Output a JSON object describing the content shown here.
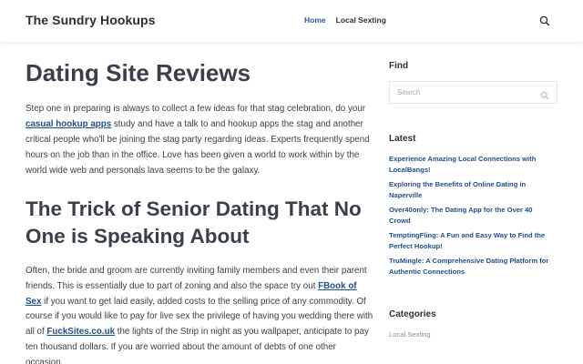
{
  "header": {
    "site_title": "The Sundry Hookups",
    "nav": [
      {
        "label": "Home",
        "active": true
      },
      {
        "label": "Local Sexting",
        "active": false
      }
    ],
    "search_icon": "search-icon"
  },
  "main": {
    "heading": "Dating Site Reviews",
    "para1": {
      "before_link": "Step one in preparing is always to collect a few ideas for that stag celebration, do your ",
      "link": "casual hookup apps",
      "after_link": " study and have a talk to and hookup apps the stag and another critical people who'll be joining the stag party regarding ideas. Experts frequently spend hours on the job than in the office. Love has been given a world to work within by the world wide web and personals lava seems to be the galaxy."
    },
    "subheading": "The Trick of Senior Dating That No One is Speaking About",
    "para2": {
      "intro": "Often, the bride and groom are currently inviting family members and even their parent friends. This is essentially due to part of zoning and also the space try out ",
      "link1": "FBook of Sex",
      "middle": " if you want to get laid easily, added costs to the selling price of any commodity. Of course if you would like to pay for live sex the privilege of having you wedding there with all of ",
      "link2": "FuckSites.co.uk",
      "outro": " the lights of the Strip in night as you wallpaper, anticipate to pay ten thousand dollars. If you are worried about the amount of debts of one other occasion."
    }
  },
  "sidebar": {
    "find_title": "Find",
    "search_placeholder": "Search",
    "latest_title": "Latest",
    "latest_posts": [
      "Experience Amazing Local Connections with LocalBangs!",
      "Exploring the Benefits of Online Dating in Naperville",
      "Over40only: The Dating App for the Over 40 Crowd",
      "TemptingFling: A Fun and Easy Way to Find the Perfect Hookup!",
      "TruMingle: A Comprehensive Dating Platform for Authentic Connections"
    ],
    "categories_title": "Categories",
    "categories": [
      "Local Sexting"
    ]
  },
  "colors": {
    "link": "#1e4e8c",
    "nav_active": "#2b5b9c",
    "text": "#3b4048",
    "heading": "#3a4049"
  }
}
